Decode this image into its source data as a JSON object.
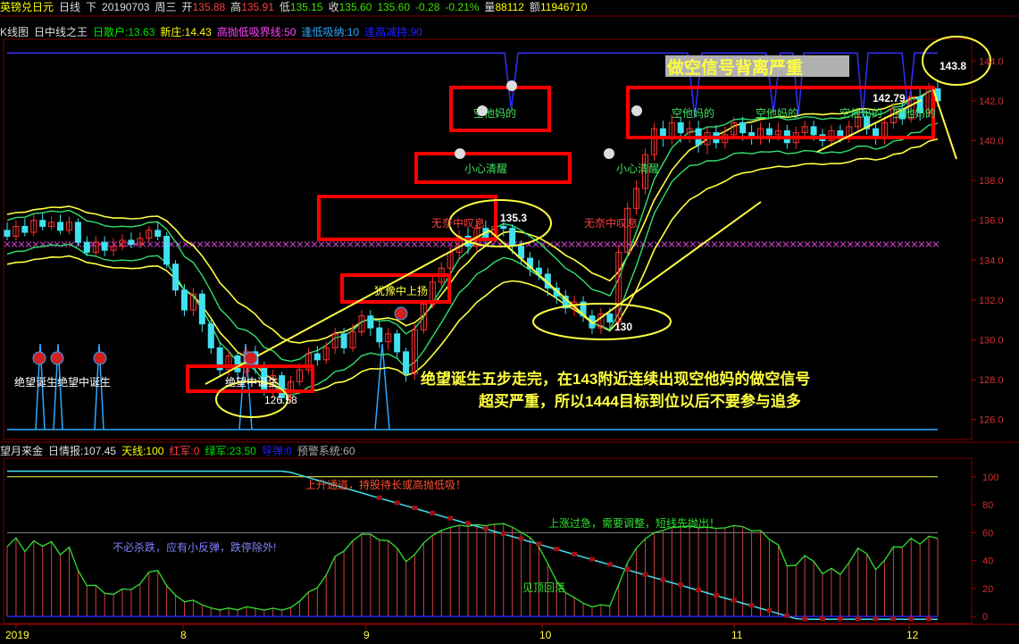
{
  "header": {
    "symbol": "英镑兑日元",
    "period": "日线",
    "adj": "下",
    "date": "20190703",
    "weekday": "周三",
    "open_label": "开",
    "open": "135.88",
    "high_label": "高",
    "high": "135.91",
    "low_label": "低",
    "low": "135.15",
    "close_label": "收",
    "close": "135.60",
    "last": "135.60",
    "change": "-0.28",
    "change_pct": "-0.21%",
    "vol_label": "量",
    "volume": "88112",
    "amt_label": "额",
    "amount": "11946710"
  },
  "indicator_main": {
    "prefix": "K线图",
    "name": "日中线之王",
    "items": [
      {
        "text": "日散户:13.63",
        "color": "#00e000"
      },
      {
        "text": "新庄:14.43",
        "color": "#ffff00"
      },
      {
        "text": "高抛低吸界线:50",
        "color": "#ff40ff"
      },
      {
        "text": "逢低吸纳:10",
        "color": "#2ea8ff"
      },
      {
        "text": "逢高减持:90",
        "color": "#2020ff"
      }
    ]
  },
  "indicator_sub": {
    "name": "望月来金",
    "items": [
      {
        "text": "日情报:107.45",
        "color": "#dddddd"
      },
      {
        "text": "天线:100",
        "color": "#ffff00"
      },
      {
        "text": "红军:0",
        "color": "#ff4040"
      },
      {
        "text": "绿军:23.50",
        "color": "#00e000"
      },
      {
        "text": "导弹:0",
        "color": "#2020ff"
      },
      {
        "text": "预警系统:60",
        "color": "#aaaaaa"
      }
    ]
  },
  "chart_data": {
    "type": "candlestick",
    "main_y_ticks": [
      126,
      128,
      130,
      132,
      134,
      136,
      138,
      140,
      142,
      144
    ],
    "ylim_main": [
      125,
      145
    ],
    "sub_y_ticks": [
      0,
      20,
      40,
      60,
      80,
      100
    ],
    "ylim_sub": [
      -5,
      112
    ],
    "x_labels": [
      "2019",
      "8",
      "9",
      "10",
      "11",
      "12"
    ],
    "candles": [
      [
        135.5,
        135.2,
        135.9,
        135.0
      ],
      [
        135.2,
        135.7,
        136.0,
        135.0
      ],
      [
        135.7,
        135.4,
        136.1,
        135.2
      ],
      [
        135.4,
        136.0,
        136.3,
        135.2
      ],
      [
        136.0,
        135.7,
        136.4,
        135.5
      ],
      [
        135.7,
        135.9,
        136.2,
        135.5
      ],
      [
        135.9,
        135.5,
        136.3,
        135.3
      ],
      [
        135.5,
        135.9,
        136.2,
        135.3
      ],
      [
        135.9,
        134.9,
        136.1,
        134.7
      ],
      [
        134.9,
        134.4,
        135.2,
        134.2
      ],
      [
        134.4,
        134.9,
        135.2,
        134.2
      ],
      [
        134.9,
        134.5,
        135.2,
        134.2
      ],
      [
        134.5,
        134.7,
        135.1,
        134.2
      ],
      [
        134.7,
        135.0,
        135.3,
        134.5
      ],
      [
        135.0,
        134.8,
        135.4,
        134.6
      ],
      [
        134.8,
        135.1,
        135.4,
        134.6
      ],
      [
        135.1,
        135.5,
        135.7,
        134.9
      ],
      [
        135.5,
        135.2,
        135.9,
        135.0
      ],
      [
        135.2,
        133.8,
        135.4,
        133.6
      ],
      [
        133.8,
        132.5,
        134.0,
        132.2
      ],
      [
        132.5,
        131.5,
        132.8,
        131.2
      ],
      [
        131.5,
        132.3,
        132.6,
        131.2
      ],
      [
        132.3,
        130.8,
        132.5,
        130.4
      ],
      [
        130.8,
        129.6,
        131.0,
        129.3
      ],
      [
        129.6,
        128.5,
        129.9,
        128.2
      ],
      [
        128.5,
        129.2,
        129.5,
        128.2
      ],
      [
        129.2,
        128.4,
        129.4,
        127.9
      ],
      [
        128.4,
        129.4,
        129.6,
        128.1
      ],
      [
        129.4,
        128.6,
        129.7,
        128.3
      ],
      [
        128.6,
        127.4,
        128.9,
        127.2
      ],
      [
        127.4,
        128.2,
        128.5,
        127.1
      ],
      [
        128.2,
        127.1,
        128.4,
        126.8
      ],
      [
        127.1,
        127.9,
        128.2,
        126.9
      ],
      [
        127.9,
        128.5,
        128.8,
        127.7
      ],
      [
        128.5,
        129.3,
        129.6,
        128.3
      ],
      [
        129.3,
        129.0,
        129.7,
        128.7
      ],
      [
        129.0,
        129.6,
        129.9,
        128.8
      ],
      [
        129.6,
        130.3,
        130.6,
        129.3
      ],
      [
        130.3,
        129.6,
        130.6,
        129.3
      ],
      [
        129.6,
        130.4,
        130.8,
        129.4
      ],
      [
        130.4,
        131.2,
        131.5,
        130.2
      ],
      [
        131.2,
        130.6,
        131.5,
        130.2
      ],
      [
        130.6,
        129.9,
        130.9,
        129.6
      ],
      [
        129.9,
        130.3,
        130.6,
        129.5
      ],
      [
        130.3,
        129.4,
        130.5,
        129.1
      ],
      [
        129.4,
        128.3,
        129.6,
        127.9
      ],
      [
        128.3,
        130.5,
        130.8,
        128.0
      ],
      [
        130.5,
        131.8,
        132.0,
        130.3
      ],
      [
        131.8,
        132.9,
        133.2,
        131.6
      ],
      [
        132.9,
        133.6,
        133.9,
        132.6
      ],
      [
        133.6,
        134.4,
        134.7,
        133.3
      ],
      [
        134.4,
        135.2,
        135.5,
        134.1
      ],
      [
        135.2,
        134.7,
        135.6,
        134.3
      ],
      [
        134.7,
        135.6,
        135.9,
        134.4
      ],
      [
        135.6,
        135.1,
        136.0,
        134.8
      ],
      [
        135.1,
        135.7,
        136.1,
        134.9
      ],
      [
        135.7,
        135.6,
        135.9,
        135.2
      ],
      [
        135.6,
        134.7,
        135.8,
        134.3
      ],
      [
        134.7,
        134.1,
        135.0,
        133.8
      ],
      [
        134.1,
        133.6,
        134.4,
        133.2
      ],
      [
        133.6,
        133.3,
        134.0,
        133.0
      ],
      [
        133.3,
        132.6,
        133.6,
        132.2
      ],
      [
        132.6,
        132.2,
        132.9,
        131.8
      ],
      [
        132.2,
        131.6,
        132.5,
        131.3
      ],
      [
        131.6,
        131.9,
        132.2,
        131.2
      ],
      [
        131.9,
        131.2,
        132.2,
        130.9
      ],
      [
        131.2,
        130.6,
        131.5,
        130.3
      ],
      [
        130.6,
        131.3,
        131.6,
        130.3
      ],
      [
        131.3,
        130.9,
        131.6,
        130.4
      ],
      [
        130.9,
        134.4,
        134.8,
        130.6
      ],
      [
        134.4,
        136.6,
        136.9,
        134.1
      ],
      [
        136.6,
        137.6,
        138.0,
        136.3
      ],
      [
        137.6,
        139.3,
        139.6,
        137.3
      ],
      [
        139.3,
        140.6,
        140.9,
        139.0
      ],
      [
        140.6,
        140.1,
        141.0,
        139.7
      ],
      [
        140.1,
        140.9,
        141.3,
        139.8
      ],
      [
        140.9,
        140.4,
        141.2,
        139.9
      ],
      [
        140.4,
        140.6,
        141.0,
        139.9
      ],
      [
        140.6,
        139.8,
        141.0,
        139.4
      ],
      [
        139.8,
        140.4,
        140.7,
        139.3
      ],
      [
        140.4,
        139.9,
        140.8,
        139.6
      ],
      [
        139.9,
        140.3,
        140.7,
        139.6
      ],
      [
        140.3,
        140.9,
        141.2,
        140.1
      ],
      [
        140.9,
        140.4,
        141.2,
        140.0
      ],
      [
        140.4,
        140.1,
        140.8,
        139.8
      ],
      [
        140.1,
        140.6,
        140.9,
        139.8
      ],
      [
        140.6,
        140.3,
        140.9,
        139.9
      ],
      [
        140.3,
        140.5,
        140.9,
        140.0
      ],
      [
        140.5,
        139.9,
        140.8,
        139.6
      ],
      [
        139.9,
        140.4,
        140.7,
        139.6
      ],
      [
        140.4,
        140.7,
        141.0,
        140.1
      ],
      [
        140.7,
        140.3,
        141.0,
        140.0
      ],
      [
        140.3,
        140.0,
        140.6,
        139.7
      ],
      [
        140.0,
        140.5,
        140.8,
        139.7
      ],
      [
        140.5,
        140.2,
        140.8,
        139.9
      ],
      [
        140.2,
        140.7,
        141.0,
        139.9
      ],
      [
        140.7,
        141.2,
        141.5,
        140.4
      ],
      [
        141.2,
        140.6,
        141.5,
        140.3
      ],
      [
        140.6,
        140.1,
        140.9,
        139.8
      ],
      [
        140.1,
        140.9,
        141.2,
        139.8
      ],
      [
        140.9,
        141.6,
        141.9,
        140.6
      ],
      [
        141.6,
        141.1,
        141.9,
        140.8
      ],
      [
        141.1,
        142.2,
        142.5,
        140.9
      ],
      [
        142.2,
        141.4,
        142.6,
        141.0
      ],
      [
        141.4,
        142.6,
        142.9,
        141.2
      ],
      [
        142.6,
        142.0,
        143.0,
        141.7
      ]
    ],
    "main_labels": [
      "空他妈的",
      "小心清醒",
      "无奈中叹息",
      "犹豫中上扬",
      "绝望中诞生",
      "绝望诞生绝望中诞生",
      "空他妈的",
      "空他妈的",
      "空他妈的",
      "空他妈的",
      "小心清醒",
      "无奈中叹息"
    ],
    "value_labels": [
      "135.3",
      "130",
      "126.58",
      "142.79",
      "143.8"
    ],
    "boxed_text": "做空信号背离严重",
    "commentary_line1": "绝望诞生五步走完，在143附近连续出现空他妈的做空信号",
    "commentary_line2": "超买严重，所以1444目标到位以后不要参与追多",
    "sub_labels": [
      "上升通道，持股待长或高抛低吸！",
      "上涨过急，需要调整，短线先抛出！",
      "不必杀跌，应有小反弹，跌停除外!",
      "见顶回落"
    ],
    "dashed_level": 134.8,
    "baseline_level": 125.5,
    "top_level": 144.4
  },
  "colors": {
    "up": "#ff3030",
    "down": "#40e0f0",
    "annot_yellow": "#ffff40",
    "box_red": "#ff0000",
    "axis_red": "#a00000"
  }
}
